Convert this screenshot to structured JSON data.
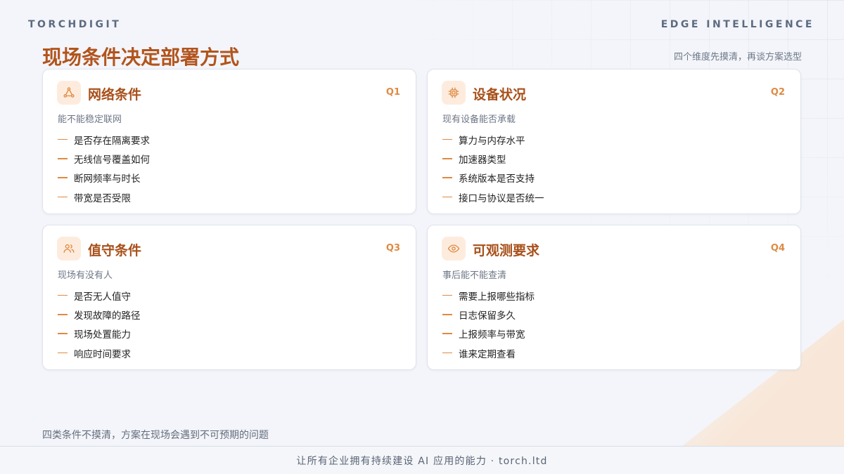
{
  "header": {
    "brand": "TORCHDIGIT",
    "brand_right": "EDGE INTELLIGENCE",
    "title": "现场条件决定部署方式",
    "subtitle": "四个维度先摸清，再谈方案选型"
  },
  "cards": [
    {
      "icon": "network-nodes-icon",
      "title": "网络条件",
      "tag": "Q1",
      "subtitle": "能不能稳定联网",
      "items": [
        "是否存在隔离要求",
        "无线信号覆盖如何",
        "断网频率与时长",
        "带宽是否受限"
      ]
    },
    {
      "icon": "chip-icon",
      "title": "设备状况",
      "tag": "Q2",
      "subtitle": "现有设备能否承载",
      "items": [
        "算力与内存水平",
        "加速器类型",
        "系统版本是否支持",
        "接口与协议是否统一"
      ]
    },
    {
      "icon": "users-icon",
      "title": "值守条件",
      "tag": "Q3",
      "subtitle": "现场有没有人",
      "items": [
        "是否无人值守",
        "发现故障的路径",
        "现场处置能力",
        "响应时间要求"
      ]
    },
    {
      "icon": "eye-icon",
      "title": "可观测要求",
      "tag": "Q4",
      "subtitle": "事后能不能查清",
      "items": [
        "需要上报哪些指标",
        "日志保留多久",
        "上报频率与带宽",
        "谁来定期查看"
      ]
    }
  ],
  "footnote": "四类条件不摸清，方案在现场会遇到不可预期的问题",
  "footer": "让所有企业拥有持续建设 AI 应用的能力 · torch.ltd",
  "colors": {
    "accent": "#b2541c",
    "accent_light": "#de8a43",
    "icon_bg": "#fdecde"
  }
}
